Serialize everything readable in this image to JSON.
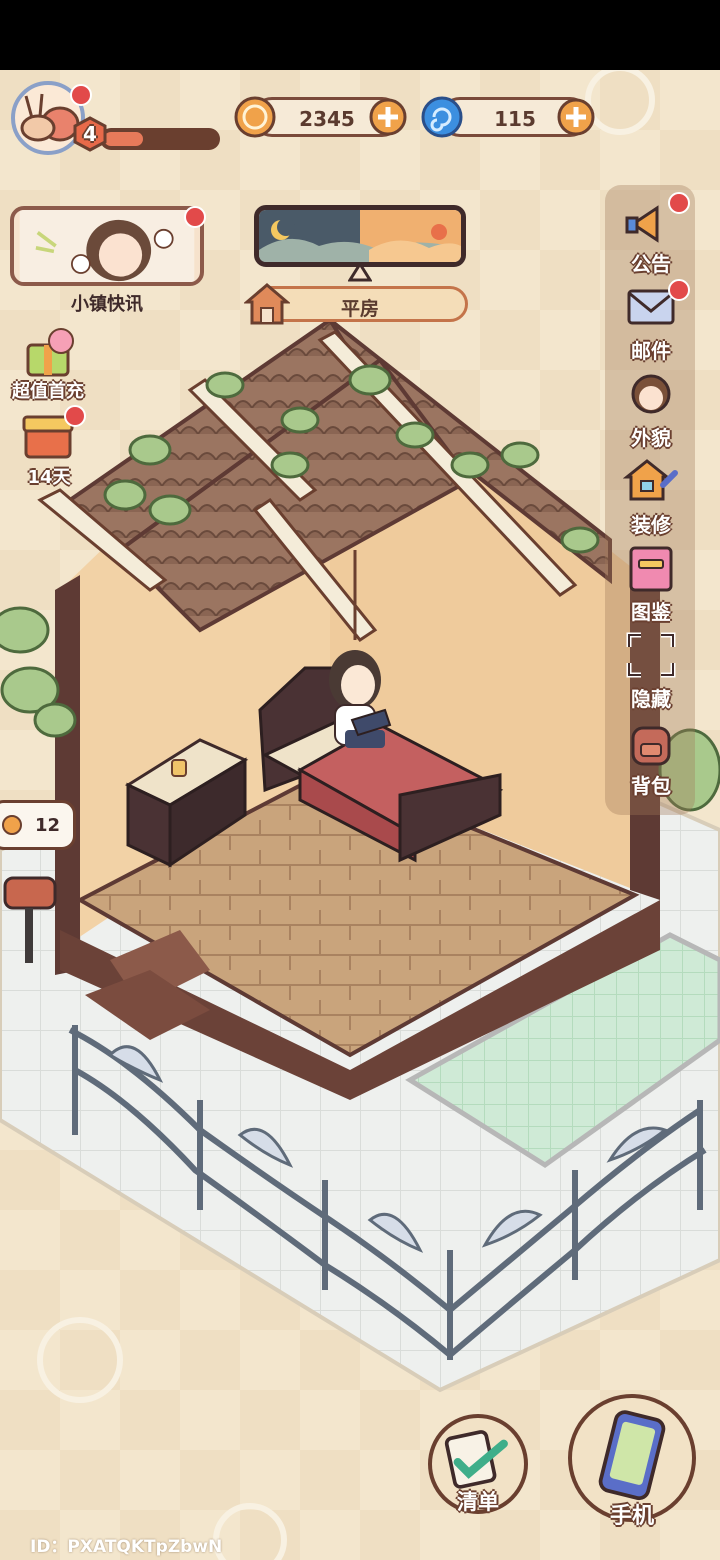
{
  "player": {
    "level": "4",
    "xp_fraction": 0.35
  },
  "currencies": {
    "coins": {
      "amount": "2345",
      "icon": "coin-icon"
    },
    "gems": {
      "amount": "115",
      "icon": "swirl-gem-icon"
    }
  },
  "news": {
    "label": "小镇快讯"
  },
  "location": {
    "label": "平房"
  },
  "left_events": [
    {
      "id": "first-recharge",
      "label": "超值首充",
      "icon": "gift-box-icon"
    },
    {
      "id": "14-day",
      "label": "14天",
      "icon": "reward-box-icon"
    }
  ],
  "side_menu": [
    {
      "id": "announcement",
      "label": "公告",
      "icon": "megaphone-icon",
      "dot": true
    },
    {
      "id": "mail",
      "label": "邮件",
      "icon": "envelope-icon",
      "dot": true
    },
    {
      "id": "appearance",
      "label": "外貌",
      "icon": "character-face-icon",
      "dot": false
    },
    {
      "id": "renovate",
      "label": "装修",
      "icon": "house-wrench-icon",
      "dot": false
    },
    {
      "id": "collection",
      "label": "图鉴",
      "icon": "book-icon",
      "dot": false
    },
    {
      "id": "hide",
      "label": "隐藏",
      "icon": "hide-frame-icon",
      "dot": false
    },
    {
      "id": "backpack",
      "label": "背包",
      "icon": "backpack-icon",
      "dot": false
    }
  ],
  "mailbox_bubble": {
    "count": "12",
    "icon": "coin-small-icon"
  },
  "bottom_buttons": {
    "checklist": {
      "label": "清单",
      "icon": "checklist-icon"
    },
    "phone": {
      "label": "手机",
      "icon": "phone-icon"
    }
  },
  "footer": {
    "player_id": "ID：PXATQKTpZbwN"
  },
  "colors": {
    "outline": "#6a3f2f",
    "badge_red": "#e24a4a",
    "coin_orange": "#f0a24a",
    "gem_blue": "#3c8fe0"
  }
}
